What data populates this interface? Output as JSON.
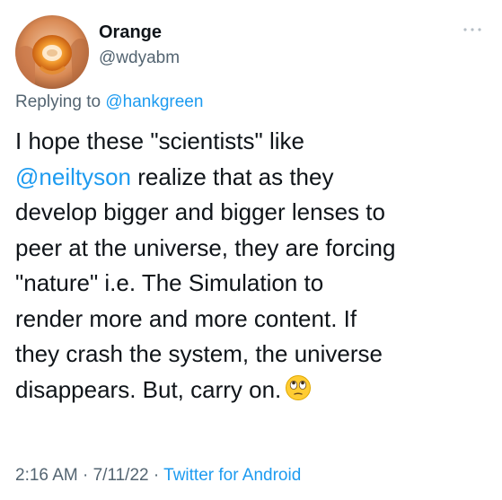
{
  "author": {
    "display_name": "Orange",
    "handle": "@wdyabm",
    "avatar_icon": "orange-object-avatar"
  },
  "more_icon": "more-horizontal-icon",
  "reply": {
    "prefix": "Replying to ",
    "handle": "@hankgreen"
  },
  "body": {
    "line1": "I hope these \"scientists\" like",
    "line2_mention": "@neiltyson",
    "line2_rest": " realize that as they",
    "line3": "develop bigger and bigger lenses to",
    "line4": "peer at the universe, they are forcing",
    "line5": "\"nature\" i.e. The Simulation to",
    "line6": "render more and more content. If",
    "line7": "they crash the system, the universe",
    "line8": "disappears. But, carry on.",
    "emoji": "face-with-rolling-eyes"
  },
  "meta": {
    "time": "2:16 AM",
    "separator1": " · ",
    "date": "7/11/22",
    "separator2": " · ",
    "source": "Twitter for Android"
  },
  "colors": {
    "text": "#0f1419",
    "secondary": "#536471",
    "link": "#1d9bf0"
  }
}
